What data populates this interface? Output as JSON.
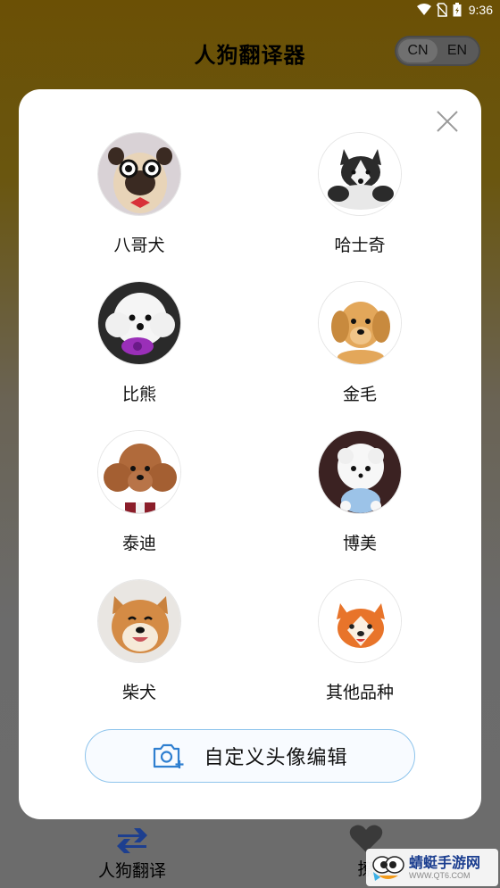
{
  "status_bar": {
    "time": "9:36"
  },
  "header": {
    "title": "人狗翻译器"
  },
  "language": {
    "options": [
      "CN",
      "EN"
    ],
    "selected": "CN"
  },
  "breed_dialog": {
    "breeds": [
      {
        "label": "八哥犬",
        "icon": "pug-avatar"
      },
      {
        "label": "哈士奇",
        "icon": "husky-avatar"
      },
      {
        "label": "比熊",
        "icon": "bichon-avatar"
      },
      {
        "label": "金毛",
        "icon": "golden-retriever-avatar"
      },
      {
        "label": "泰迪",
        "icon": "teddy-avatar"
      },
      {
        "label": "博美",
        "icon": "pomeranian-avatar"
      },
      {
        "label": "柴犬",
        "icon": "shiba-avatar"
      },
      {
        "label": "其他品种",
        "icon": "shiba-cartoon-avatar"
      }
    ],
    "custom_button_label": "自定义头像编辑"
  },
  "bottom_nav": {
    "translate_label": "人狗翻译",
    "favorite_label": "撩"
  },
  "watermark": {
    "title": "蜻蜓手游网",
    "url": "WWW.QT6.COM"
  },
  "colors": {
    "header_bg": "#6b5005",
    "modal_bg": "#ffffff",
    "custom_button_border": "#8ec4ec",
    "accent_blue": "#2f7fd0",
    "nav_icon": "#1d3f8f"
  }
}
